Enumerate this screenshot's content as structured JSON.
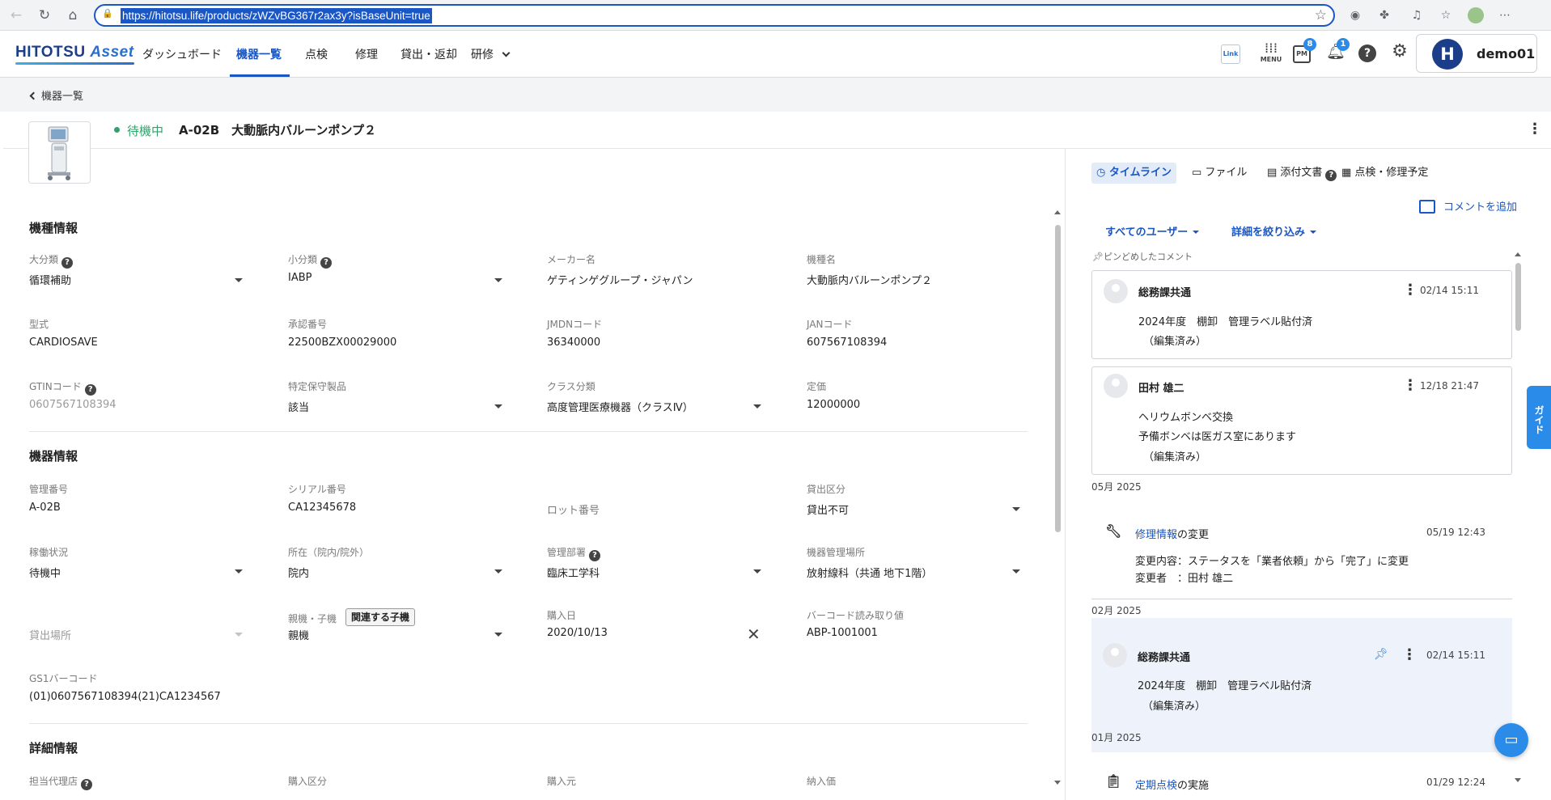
{
  "browser": {
    "url": "https://hitotsu.life/products/zWZvBG367r2ax3y?isBaseUnit=true"
  },
  "header": {
    "logo_main": "HITOTSU",
    "logo_accent": "Asset",
    "nav": [
      "ダッシュボード",
      "機器一覧",
      "点検",
      "修理",
      "貸出・返却",
      "研修"
    ],
    "link_label": "Link",
    "menu_label": "MENU",
    "pmda_badge": "8",
    "notification_badge": "1",
    "help_glyph": "?",
    "avatar_initial": "H",
    "user_name": "demo01"
  },
  "breadcrumb": {
    "back_label": "機器一覧"
  },
  "equipment": {
    "status": "待機中",
    "title": "A-02B　大動脈内バルーンポンプ２"
  },
  "sections": {
    "model_info": "機種情報",
    "device_info": "機器情報",
    "detail_info": "詳細情報"
  },
  "fields": {
    "category_large": {
      "label": "大分類",
      "value": "循環補助"
    },
    "category_small": {
      "label": "小分類",
      "value": "IABP"
    },
    "maker": {
      "label": "メーカー名",
      "value": "ゲティンゲグループ・ジャパン"
    },
    "model_name": {
      "label": "機種名",
      "value": "大動脈内バルーンポンプ２"
    },
    "model_type": {
      "label": "型式",
      "value": "CARDIOSAVE"
    },
    "approval_no": {
      "label": "承認番号",
      "value": "22500BZX00029000"
    },
    "jmdn": {
      "label": "JMDNコード",
      "value": "36340000"
    },
    "jan": {
      "label": "JANコード",
      "value": "607567108394"
    },
    "gtin": {
      "label": "GTINコード",
      "value": "0607567108394"
    },
    "special_maint": {
      "label": "特定保守製品",
      "value": "該当"
    },
    "class": {
      "label": "クラス分類",
      "value": "高度管理医療機器（クラスⅣ）"
    },
    "list_price": {
      "label": "定価",
      "value": "12000000"
    },
    "mgmt_no": {
      "label": "管理番号",
      "value": "A-02B"
    },
    "serial_no": {
      "label": "シリアル番号",
      "value": "CA12345678"
    },
    "lot_no": {
      "label": "",
      "value": "ロット番号"
    },
    "lending_type": {
      "label": "貸出区分",
      "value": "貸出不可"
    },
    "operation": {
      "label": "稼働状況",
      "value": "待機中"
    },
    "location": {
      "label": "所在（院内/院外）",
      "value": "院内"
    },
    "dept": {
      "label": "管理部署",
      "value": "臨床工学科"
    },
    "storage": {
      "label": "機器管理場所",
      "value": "放射線科（共通 地下1階）"
    },
    "lend_place": {
      "label": "",
      "value": "貸出場所"
    },
    "parent_child": {
      "label": "親機・子機",
      "value": "親機",
      "button": "関連する子機"
    },
    "purchase_date": {
      "label": "購入日",
      "value": "2020/10/13"
    },
    "barcode": {
      "label": "バーコード読み取り値",
      "value": "ABP-1001001"
    },
    "gs1": {
      "label": "GS1バーコード",
      "value": "(01)0607567108394(21)CA1234567"
    },
    "agent": {
      "label": "担当代理店"
    },
    "purchase_type": {
      "label": "購入区分"
    },
    "vendor": {
      "label": "購入元"
    },
    "delivery_price": {
      "label": "納入価"
    }
  },
  "right_panel": {
    "tabs": [
      "タイムライン",
      "ファイル",
      "添付文書",
      "点検・修理予定"
    ],
    "add_comment": "コメントを追加",
    "filter_users": "すべてのユーザー",
    "filter_detail": "詳細を絞り込み",
    "pinned_label": "ピンどめしたコメント",
    "pinned": [
      {
        "name": "総務課共通",
        "time": "02/14 15:11",
        "lines": [
          "2024年度　棚卸　管理ラベル貼付済"
        ],
        "edited": "（編集済み）"
      },
      {
        "name": "田村 雄二",
        "time": "12/18 21:47",
        "lines": [
          "ヘリウムボンベ交換",
          "予備ボンベは医ガス室にあります"
        ],
        "edited": "（編集済み）"
      }
    ],
    "months": [
      "05月 2025",
      "02月 2025",
      "01月 2025"
    ],
    "repair_event": {
      "title_link": "修理情報",
      "title_suffix": "の変更",
      "time": "05/19 12:43",
      "line1": "変更内容：ステータスを「業者依頼」から「完了」に変更",
      "line2": "変更者　：田村 雄二"
    },
    "feb_comment": {
      "name": "総務課共通",
      "time": "02/14 15:11",
      "line": "2024年度　棚卸　管理ラベル貼付済",
      "edited": "（編集済み）"
    },
    "inspection_event": {
      "title_link": "定期点検",
      "title_suffix": "の実施",
      "time": "01/29 12:24"
    },
    "guide_label": "ガイド"
  },
  "colors": {
    "primary": "#1a56c4",
    "status_green": "#2fa36b",
    "badge_blue": "#2a8be8"
  }
}
